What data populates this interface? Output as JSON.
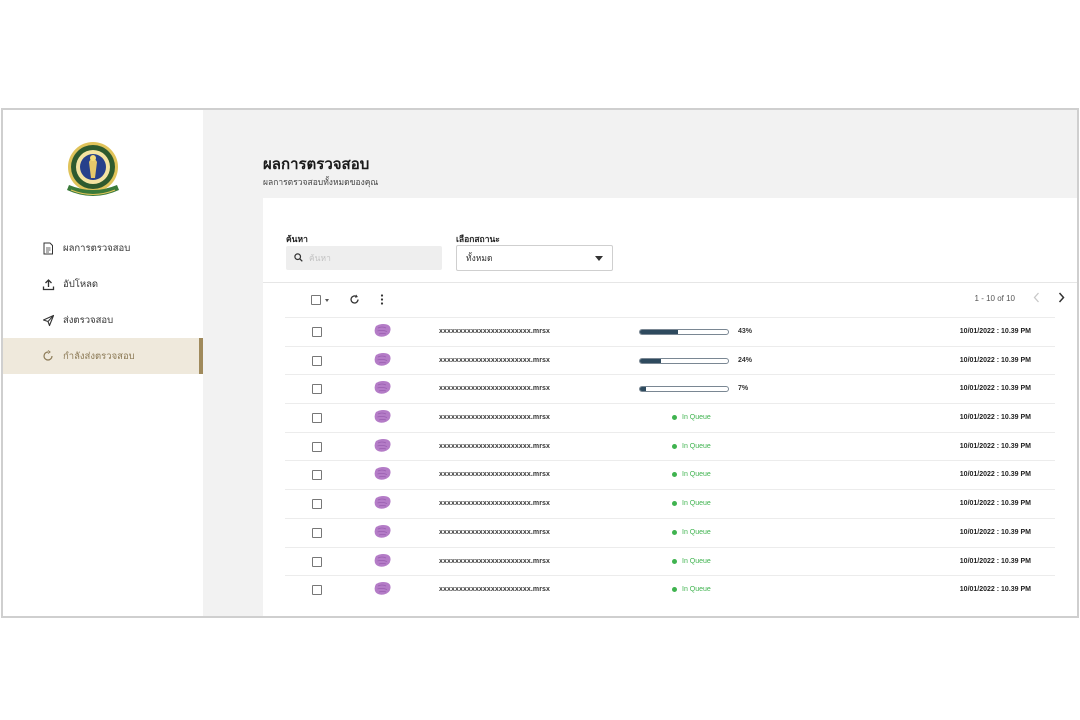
{
  "colors": {
    "accent": "#a08a5c",
    "active_bg": "#efe9dc",
    "progress": "#2e4a5e",
    "queue_green": "#3fb34f",
    "thumbnail": "#b47cc7"
  },
  "sidebar": {
    "logo_icon": "university-seal-icon",
    "items": [
      {
        "label": "ผลการตรวจสอบ",
        "icon": "document-icon",
        "active": false
      },
      {
        "label": "อัปโหลด",
        "icon": "upload-icon",
        "active": false
      },
      {
        "label": "ส่งตรวจสอบ",
        "icon": "send-icon",
        "active": false
      },
      {
        "label": "กำลังส่งตรวจสอบ",
        "icon": "loading-icon",
        "active": true
      }
    ]
  },
  "header": {
    "title": "ผลการตรวจสอบ",
    "subtitle": "ผลการตรวจสอบทั้งหมดของคุณ"
  },
  "filters": {
    "search_label": "ค้นหา",
    "search_placeholder": "ค้นหา",
    "status_label": "เลือกสถานะ",
    "status_value": "ทั้งหมด"
  },
  "toolbar": {
    "select_all_icon": "checkbox-icon",
    "refresh_icon": "refresh-icon",
    "more_icon": "more-vertical-icon"
  },
  "pagination": {
    "text": "1 - 10 of 10",
    "prev_icon": "chevron-left-icon",
    "next_icon": "chevron-right-icon"
  },
  "rows": [
    {
      "filename": "xxxxxxxxxxxxxxxxxxxxxxx.mrsx",
      "status": "progress",
      "progress": 43,
      "progress_text": "43%",
      "date": "10/01/2022 : 10.39 PM"
    },
    {
      "filename": "xxxxxxxxxxxxxxxxxxxxxxx.mrsx",
      "status": "progress",
      "progress": 24,
      "progress_text": "24%",
      "date": "10/01/2022 : 10.39 PM"
    },
    {
      "filename": "xxxxxxxxxxxxxxxxxxxxxxx.mrsx",
      "status": "progress",
      "progress": 7,
      "progress_text": "7%",
      "date": "10/01/2022 : 10.39 PM"
    },
    {
      "filename": "xxxxxxxxxxxxxxxxxxxxxxx.mrsx",
      "status": "queue",
      "status_text": "In Queue",
      "date": "10/01/2022 : 10.39 PM"
    },
    {
      "filename": "xxxxxxxxxxxxxxxxxxxxxxx.mrsx",
      "status": "queue",
      "status_text": "In Queue",
      "date": "10/01/2022 : 10.39 PM"
    },
    {
      "filename": "xxxxxxxxxxxxxxxxxxxxxxx.mrsx",
      "status": "queue",
      "status_text": "In Queue",
      "date": "10/01/2022 : 10.39 PM"
    },
    {
      "filename": "xxxxxxxxxxxxxxxxxxxxxxx.mrsx",
      "status": "queue",
      "status_text": "In Queue",
      "date": "10/01/2022 : 10.39 PM"
    },
    {
      "filename": "xxxxxxxxxxxxxxxxxxxxxxx.mrsx",
      "status": "queue",
      "status_text": "In Queue",
      "date": "10/01/2022 : 10.39 PM"
    },
    {
      "filename": "xxxxxxxxxxxxxxxxxxxxxxx.mrsx",
      "status": "queue",
      "status_text": "In Queue",
      "date": "10/01/2022 : 10.39 PM"
    },
    {
      "filename": "xxxxxxxxxxxxxxxxxxxxxxx.mrsx",
      "status": "queue",
      "status_text": "In Queue",
      "date": "10/01/2022 : 10.39 PM"
    }
  ]
}
